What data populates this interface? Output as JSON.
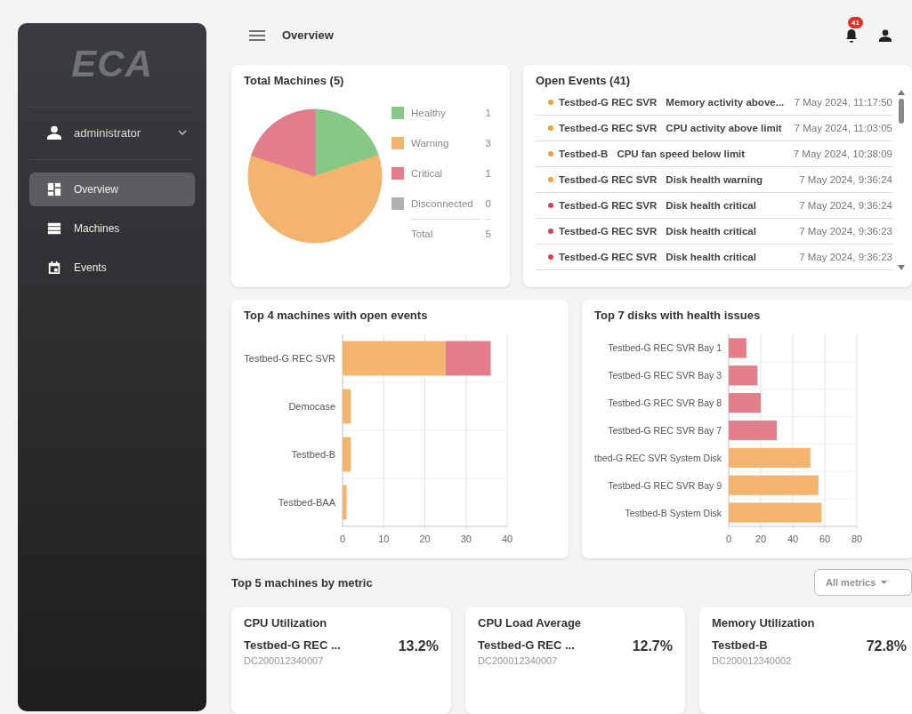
{
  "sidebar": {
    "logo": "ECA",
    "user": {
      "name": "administrator"
    },
    "items": [
      {
        "label": "Overview",
        "selected": true
      },
      {
        "label": "Machines",
        "selected": false
      },
      {
        "label": "Events",
        "selected": false
      }
    ]
  },
  "header": {
    "title": "Overview",
    "notification_count": "41"
  },
  "total_machines": {
    "title": "Total Machines (5)",
    "chart_data": {
      "type": "pie",
      "categories": [
        "Healthy",
        "Warning",
        "Critical",
        "Disconnected"
      ],
      "values": [
        20,
        60,
        20,
        0
      ],
      "legend": "right"
    },
    "legend": [
      {
        "count": "1",
        "color": "#86c986"
      },
      {
        "count": "3",
        "color": "#f2b46f"
      },
      {
        "count": "1",
        "color": "#e27d8a"
      },
      {
        "count": "0",
        "color": "#b0b0b0"
      }
    ],
    "total": {
      "label": "Total",
      "count": "5"
    }
  },
  "open_events": {
    "title": "Open Events (41)",
    "events": [
      {
        "machine": "Testbed-G REC SVR",
        "message": "Memory activity above...",
        "time": "7 May 2024, 11:17:50",
        "color": "#f0a040"
      },
      {
        "machine": "Testbed-G REC SVR",
        "message": "CPU activity above limit",
        "time": "7 May 2024, 11:03:05",
        "color": "#f0a040"
      },
      {
        "machine": "Testbed-B",
        "message": "CPU fan speed below limit",
        "time": "7 May 2024, 10:38:09",
        "color": "#f0a040"
      },
      {
        "machine": "Testbed-G REC SVR",
        "message": "Disk health warning",
        "time": "7 May 2024, 9:36:24",
        "color": "#f0a040"
      },
      {
        "machine": "Testbed-G REC SVR",
        "message": "Disk health critical",
        "time": "7 May 2024, 9:36:24",
        "color": "#d9415a"
      },
      {
        "machine": "Testbed-G REC SVR",
        "message": "Disk health critical",
        "time": "7 May 2024, 9:36:23",
        "color": "#d9415a"
      },
      {
        "machine": "Testbed-G REC SVR",
        "message": "Disk health critical",
        "time": "7 May 2024, 9:36:23",
        "color": "#d9415a"
      }
    ]
  },
  "top_machines": {
    "title": "Top 4 machines with open events",
    "chart_data": {
      "type": "bar",
      "orientation": "horizontal",
      "stacked": true,
      "categories": [
        "Testbed-G REC SVR",
        "Democase",
        "Testbed-B",
        "Testbed-BAA"
      ],
      "series": [
        {
          "color": "#f2b46f",
          "values": [
            25,
            2,
            2,
            1
          ]
        },
        {
          "color": "#e27d8a",
          "values": [
            11,
            0,
            0,
            0
          ]
        }
      ],
      "xlim": [
        0,
        40
      ],
      "xticks": [
        0,
        10,
        20,
        30,
        40
      ],
      "grid": true
    }
  },
  "top_disks": {
    "title": "Top 7 disks with health issues",
    "chart_data": {
      "type": "bar",
      "orientation": "horizontal",
      "stacked": true,
      "categories": [
        "Testbed-G REC SVR Bay 1",
        "Testbed-G REC SVR Bay 3",
        "Testbed-G REC SVR Bay 8",
        "Testbed-G REC SVR Bay 7",
        "tbed-G REC SVR System Disk",
        "Testbed-G REC SVR Bay 9",
        "Testbed-B System Disk"
      ],
      "series": [
        {
          "color": "#e27d8a",
          "values": [
            11,
            18,
            20,
            30,
            null,
            null,
            null
          ]
        },
        {
          "color": "#f2b46f",
          "values": [
            null,
            null,
            null,
            null,
            51,
            56,
            58
          ]
        }
      ],
      "xlim": [
        0,
        80
      ],
      "xticks": [
        0,
        20,
        40,
        60,
        80
      ],
      "grid": true
    }
  },
  "metrics": {
    "title": "Top 5 machines by metric",
    "filter": {
      "label": "All metrics"
    },
    "cards": [
      {
        "title": "CPU Utilization",
        "entries": [
          {
            "machine": "Testbed-G REC ...",
            "id": "DC200012340007",
            "value": "13.2%"
          }
        ]
      },
      {
        "title": "CPU Load Average",
        "entries": [
          {
            "machine": "Testbed-G REC ...",
            "id": "DC200012340007",
            "value": "12.7%"
          }
        ]
      },
      {
        "title": "Memory Utilization",
        "entries": [
          {
            "machine": "Testbed-B",
            "id": "DC200012340002",
            "value": "72.8%"
          }
        ]
      }
    ]
  }
}
